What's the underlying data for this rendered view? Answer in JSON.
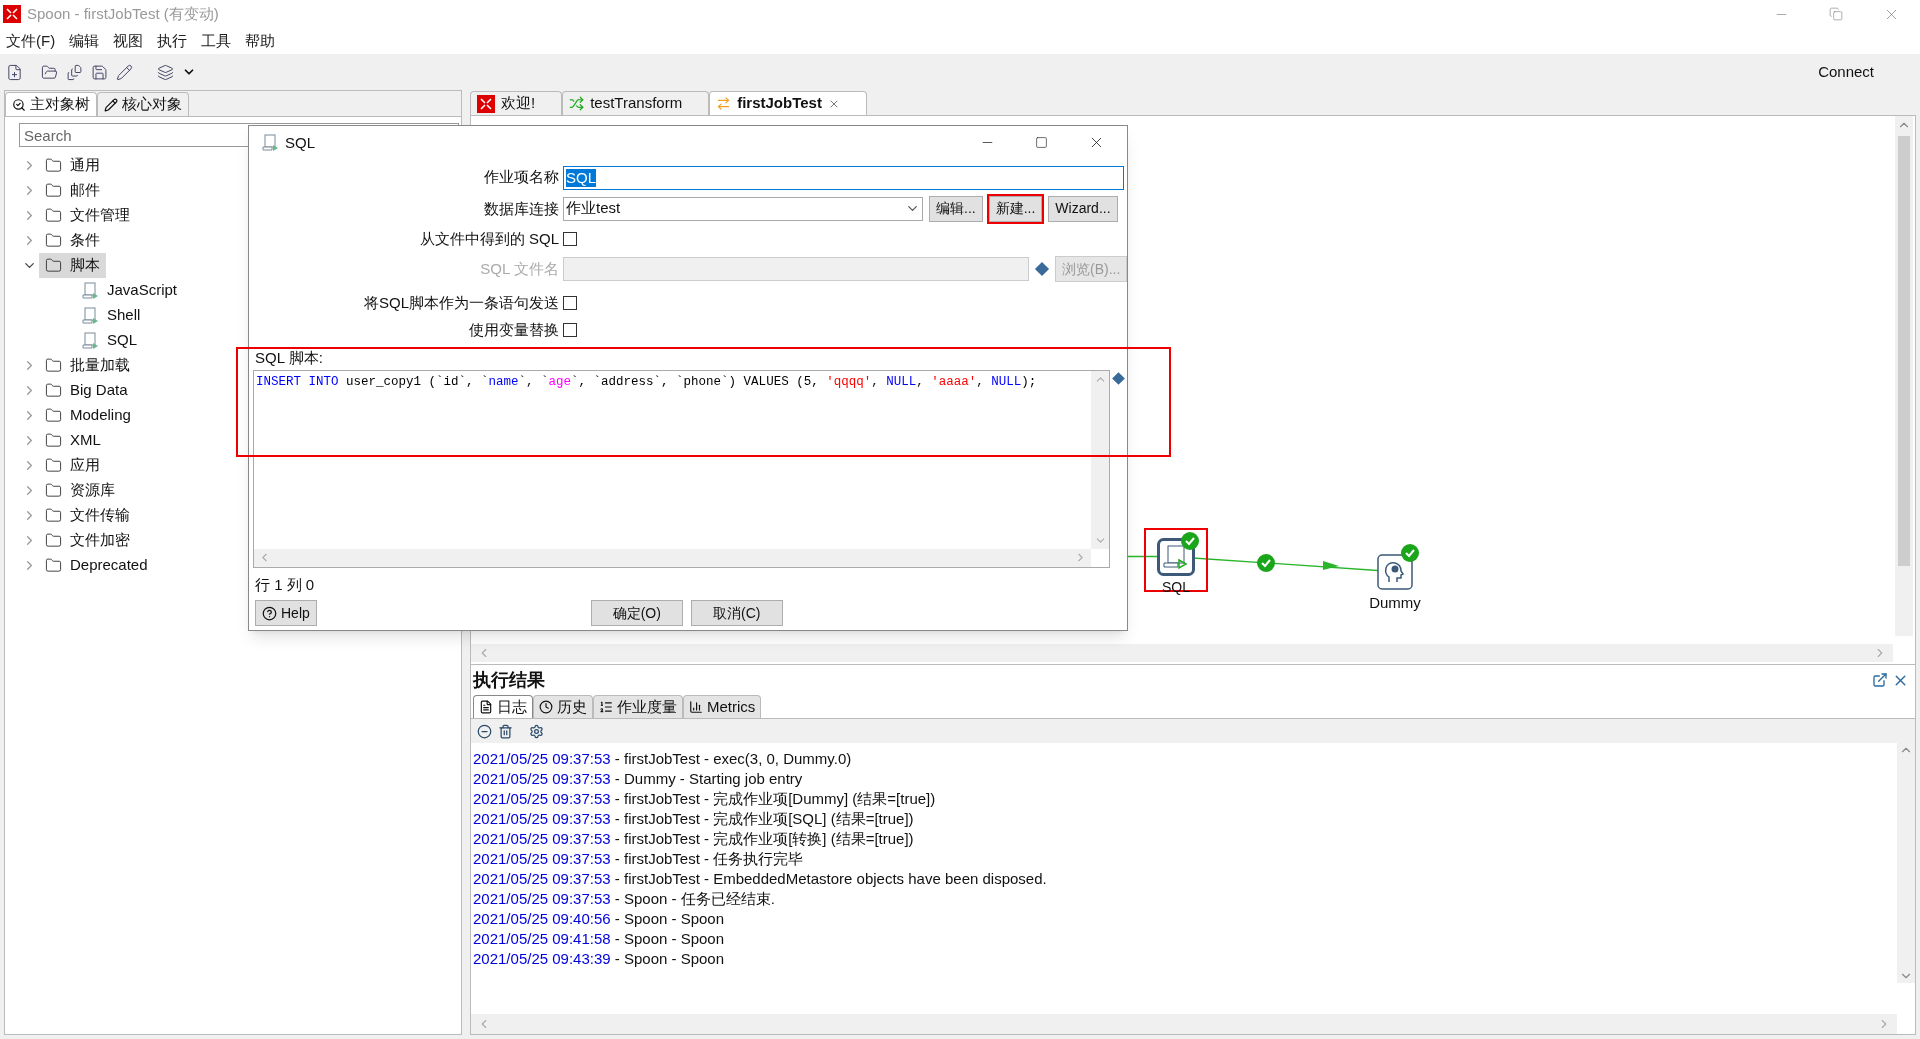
{
  "window": {
    "title": "Spoon - firstJobTest (有变动)"
  },
  "menu": [
    "文件(F)",
    "编辑",
    "视图",
    "执行",
    "工具",
    "帮助"
  ],
  "toolbar": {
    "connect": "Connect"
  },
  "left_tabs": [
    {
      "label": "主对象树",
      "selected": true
    },
    {
      "label": "核心对象",
      "selected": false
    }
  ],
  "search": {
    "placeholder": "Search"
  },
  "tree": [
    {
      "label": "通用",
      "kind": "folder",
      "expanded": false,
      "selected": false
    },
    {
      "label": "邮件",
      "kind": "folder",
      "expanded": false,
      "selected": false
    },
    {
      "label": "文件管理",
      "kind": "folder",
      "expanded": false,
      "selected": false
    },
    {
      "label": "条件",
      "kind": "folder",
      "expanded": false,
      "selected": false
    },
    {
      "label": "脚本",
      "kind": "folder",
      "expanded": true,
      "selected": true,
      "children": [
        {
          "label": "JavaScript",
          "kind": "script",
          "selected": false
        },
        {
          "label": "Shell",
          "kind": "script",
          "selected": false
        },
        {
          "label": "SQL",
          "kind": "script",
          "selected": false
        }
      ]
    },
    {
      "label": "批量加载",
      "kind": "folder",
      "expanded": false,
      "selected": false
    },
    {
      "label": "Big Data",
      "kind": "folder",
      "expanded": false,
      "selected": false
    },
    {
      "label": "Modeling",
      "kind": "folder",
      "expanded": false,
      "selected": false
    },
    {
      "label": "XML",
      "kind": "folder",
      "expanded": false,
      "selected": false
    },
    {
      "label": "应用",
      "kind": "folder",
      "expanded": false,
      "selected": false
    },
    {
      "label": "资源库",
      "kind": "folder",
      "expanded": false,
      "selected": false
    },
    {
      "label": "文件传输",
      "kind": "folder",
      "expanded": false,
      "selected": false
    },
    {
      "label": "文件加密",
      "kind": "folder",
      "expanded": false,
      "selected": false
    },
    {
      "label": "Deprecated",
      "kind": "folder",
      "expanded": false,
      "selected": false
    }
  ],
  "editor_tabs": [
    {
      "label": "欢迎!",
      "kind": "welcome",
      "selected": false
    },
    {
      "label": "testTransform",
      "kind": "transform",
      "selected": false
    },
    {
      "label": "firstJobTest",
      "kind": "job",
      "selected": true
    }
  ],
  "canvas": {
    "nodes": [
      {
        "label": "SQL",
        "kind": "sql",
        "highlighted": true
      },
      {
        "label": "Dummy",
        "kind": "dummy",
        "highlighted": false
      }
    ]
  },
  "dialog": {
    "title": "SQL",
    "job_name": {
      "label": "作业项名称",
      "value": "SQL"
    },
    "connection": {
      "label": "数据库连接",
      "value": "作业test",
      "buttons": [
        {
          "label": "编辑...",
          "highlighted": false
        },
        {
          "label": "新建...",
          "highlighted": true
        },
        {
          "label": "Wizard...",
          "highlighted": false
        }
      ]
    },
    "sql_from_file": {
      "label": "从文件中得到的 SQL",
      "checked": false
    },
    "sql_filename": {
      "label": "SQL 文件名",
      "disabled": true,
      "browse": "浏览(B)..."
    },
    "send_as_one": {
      "label": "将SQL脚本作为一条语句发送",
      "checked": false
    },
    "use_variables": {
      "label": "使用变量替换",
      "checked": false
    },
    "script": {
      "label": "SQL 脚本:",
      "highlighted": true,
      "tokens": [
        {
          "text": "INSERT INTO",
          "color": "#0000ff"
        },
        {
          "text": " user_copy1 (`id`, `",
          "color": "#000000"
        },
        {
          "text": "name",
          "color": "#0000ff"
        },
        {
          "text": "`, `"
        },
        {
          "text": "age",
          "color": "#ff00ff"
        },
        {
          "text": "`, `address`, `phone`) VALUES (5, ",
          "color": "#000000"
        },
        {
          "text": "'qqqq'",
          "color": "#ff0000"
        },
        {
          "text": ", "
        },
        {
          "text": "NULL",
          "color": "#0000ff"
        },
        {
          "text": ", "
        },
        {
          "text": "'aaaa'",
          "color": "#ff0000"
        },
        {
          "text": ", "
        },
        {
          "text": "NULL",
          "color": "#0000ff"
        },
        {
          "text": ");",
          "color": "#000000"
        }
      ]
    },
    "position": "行 1 列 0",
    "help": "Help",
    "ok": "确定(O)",
    "cancel": "取消(C)"
  },
  "results": {
    "title": "执行结果",
    "tabs": [
      {
        "label": "日志",
        "kind": "log",
        "selected": true
      },
      {
        "label": "历史",
        "kind": "history",
        "selected": false
      },
      {
        "label": "作业度量",
        "kind": "metrics",
        "selected": false
      },
      {
        "label": "Metrics",
        "kind": "chart",
        "selected": false
      }
    ],
    "log": [
      {
        "time": "2021/05/25 09:37:53",
        "text": " - firstJobTest - exec(3, 0, Dummy.0)"
      },
      {
        "time": "2021/05/25 09:37:53",
        "text": " - Dummy - Starting job entry"
      },
      {
        "time": "2021/05/25 09:37:53",
        "text": " - firstJobTest - 完成作业项[Dummy] (结果=[true])"
      },
      {
        "time": "2021/05/25 09:37:53",
        "text": " - firstJobTest - 完成作业项[SQL] (结果=[true])"
      },
      {
        "time": "2021/05/25 09:37:53",
        "text": " - firstJobTest - 完成作业项[转换] (结果=[true])"
      },
      {
        "time": "2021/05/25 09:37:53",
        "text": " - firstJobTest - 任务执行完毕"
      },
      {
        "time": "2021/05/25 09:37:53",
        "text": " - firstJobTest - EmbeddedMetastore objects have been disposed."
      },
      {
        "time": "2021/05/25 09:37:53",
        "text": " - Spoon - 任务已经结束."
      },
      {
        "time": "2021/05/25 09:40:56",
        "text": " - Spoon - Spoon"
      },
      {
        "time": "2021/05/25 09:41:58",
        "text": " - Spoon - Spoon"
      },
      {
        "time": "2021/05/25 09:43:39",
        "text": " - Spoon - Spoon"
      }
    ]
  }
}
